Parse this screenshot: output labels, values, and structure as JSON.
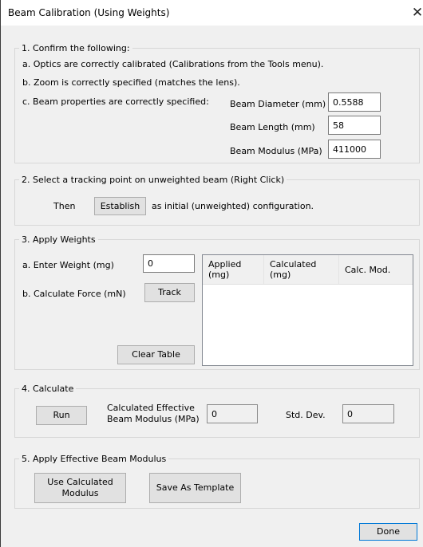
{
  "window": {
    "title": "Beam Calibration (Using Weights)",
    "close_glyph": "✕"
  },
  "section1": {
    "legend": "1.  Confirm the following:",
    "line_a": "a.  Optics are correctly calibrated (Calibrations from the Tools menu).",
    "line_b": "b.  Zoom is correctly specified (matches the lens).",
    "line_c": "c.  Beam properties are correctly specified:",
    "diameter_label": "Beam Diameter (mm)",
    "diameter_value": "0.5588",
    "length_label": "Beam Length (mm)",
    "length_value": "58",
    "modulus_label": "Beam Modulus (MPa)",
    "modulus_value": "411000"
  },
  "section2": {
    "legend": "2.  Select a tracking point on unweighted beam (Right Click)",
    "then_label": "Then",
    "establish_button": "Establish",
    "after_label": "as initial (unweighted) configuration."
  },
  "section3": {
    "legend": "3.  Apply Weights",
    "weight_label": "a.  Enter Weight (mg)",
    "weight_value": "0",
    "force_label": "b.  Calculate Force (mN)",
    "track_button": "Track",
    "clear_button": "Clear Table",
    "table": {
      "columns": [
        "Applied (mg)",
        "Calculated (mg)",
        "Calc. Mod."
      ],
      "rows": []
    }
  },
  "section4": {
    "legend": "4.  Calculate",
    "run_button": "Run",
    "effective_label_line1": "Calculated Effective",
    "effective_label_line2": "Beam Modulus (MPa)",
    "effective_value": "0",
    "stddev_label": "Std. Dev.",
    "stddev_value": "0"
  },
  "section5": {
    "legend": "5.  Apply Effective Beam Modulus",
    "use_button_line1": "Use Calculated",
    "use_button_line2": "Modulus",
    "save_template_button": "Save As Template"
  },
  "footer": {
    "done_button": "Done"
  },
  "icons": {
    "close": "close-icon"
  }
}
